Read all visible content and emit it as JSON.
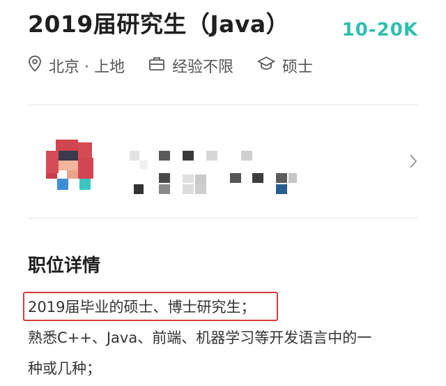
{
  "job": {
    "title": "2019届研究生（Java）",
    "salary": "10-20K",
    "location": "北京 · 上地",
    "experience": "经验不限",
    "education": "硕士"
  },
  "icons": {
    "location": "location-pin-icon",
    "experience": "briefcase-icon",
    "education": "graduation-cap-icon",
    "chevron": "chevron-right-icon"
  },
  "colors": {
    "salary": "#2fbfb0",
    "highlight_border": "#d63a3a"
  },
  "section": {
    "title": "职位详情"
  },
  "description": {
    "lines": [
      "2019届毕业的硕士、博士研究生；",
      "熟悉C++、Java、前端、机器学习等开发语言中的一",
      "种或几种；"
    ]
  }
}
